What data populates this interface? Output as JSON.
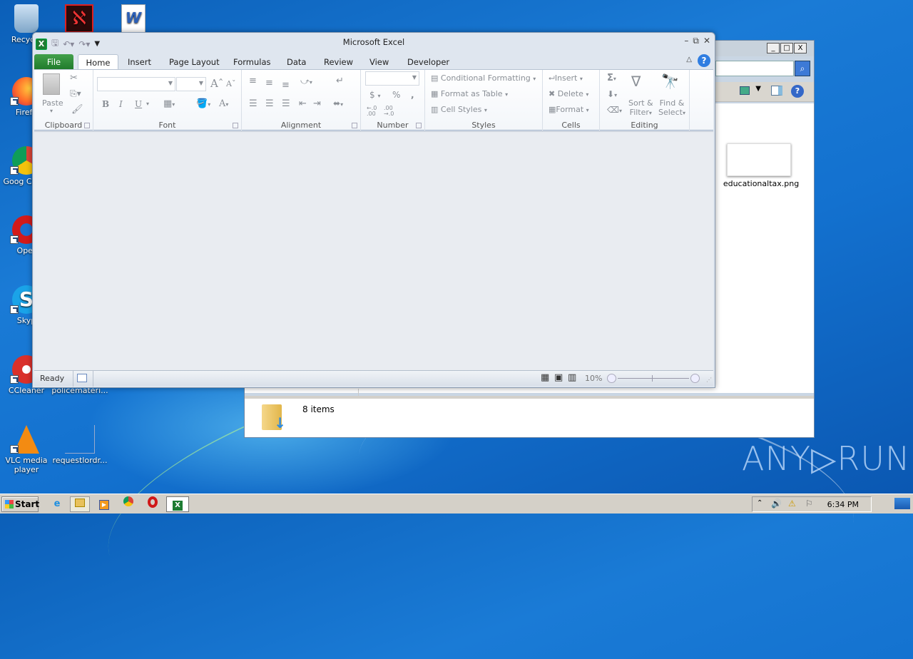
{
  "desktop": {
    "icons": [
      {
        "label": "Recycle Bin",
        "shown": "Recycle"
      },
      {
        "label": "Adobe Acrobat",
        "shown": ""
      },
      {
        "label": "Word document",
        "shown": ""
      },
      {
        "label": "Firefox",
        "shown": "Firefo"
      },
      {
        "label": "Google Chrome",
        "shown": "Goog Chron"
      },
      {
        "label": "Opera",
        "shown": "Oper"
      },
      {
        "label": "Skype",
        "shown": "Skyp"
      },
      {
        "label": "CCleaner",
        "shown": "CCleaner"
      },
      {
        "label": "policemateri...",
        "shown": "policemateri..."
      },
      {
        "label": "VLC media player",
        "shown": "VLC media player"
      },
      {
        "label": "requestlordr...",
        "shown": "requestlordr..."
      }
    ],
    "watermark": "ANY RUN"
  },
  "explorer": {
    "file_name": "educationaltax.png",
    "status_items": "8 items",
    "controls": {
      "minimize": "_",
      "maximize": "□",
      "close": "X"
    }
  },
  "excel": {
    "title": "Microsoft Excel",
    "tabs": [
      "File",
      "Home",
      "Insert",
      "Page Layout",
      "Formulas",
      "Data",
      "Review",
      "View",
      "Developer"
    ],
    "active_tab": "Home",
    "groups": {
      "clipboard": {
        "label": "Clipboard",
        "paste": "Paste"
      },
      "font": {
        "label": "Font",
        "font_name": "",
        "font_size": "",
        "bold": "B",
        "italic": "I",
        "underline": "U",
        "grow": "A",
        "shrink": "A",
        "font_color": "A"
      },
      "alignment": {
        "label": "Alignment"
      },
      "number": {
        "label": "Number",
        "format": "",
        "currency": "$",
        "percent": "%",
        "comma": ",",
        "inc_decimal": "←.0 .00",
        "dec_decimal": ".00 →.0"
      },
      "styles": {
        "label": "Styles",
        "conditional": "Conditional Formatting",
        "format_table": "Format as Table",
        "cell_styles": "Cell Styles"
      },
      "cells": {
        "label": "Cells",
        "insert": "Insert",
        "delete": "Delete",
        "format": "Format"
      },
      "editing": {
        "label": "Editing",
        "autosum": "Σ",
        "sort_filter_1": "Sort &",
        "sort_filter_2": "Filter",
        "find_select_1": "Find &",
        "find_select_2": "Select"
      }
    },
    "status": {
      "text": "Ready",
      "zoom": "10%"
    }
  },
  "taskbar": {
    "start": "Start",
    "clock": "6:34 PM",
    "apps": [
      "Internet Explorer",
      "Windows Explorer",
      "Windows Media Player",
      "Google Chrome",
      "Opera",
      "Microsoft Excel"
    ]
  }
}
